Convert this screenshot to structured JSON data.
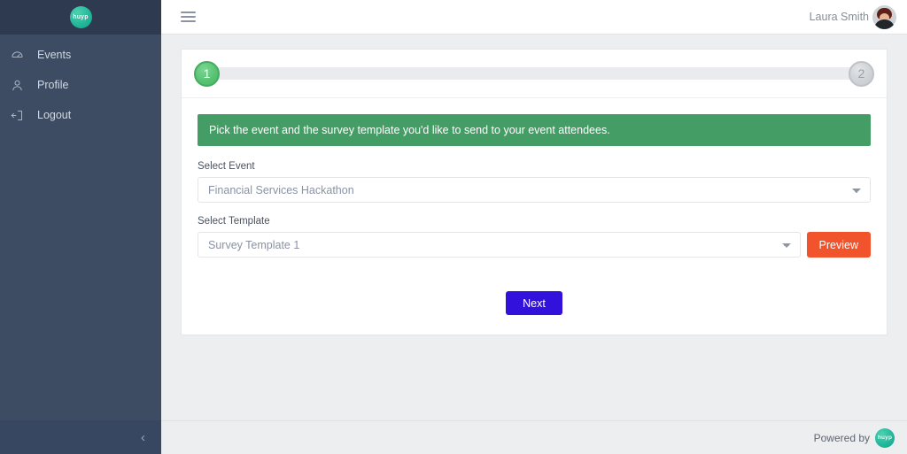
{
  "brand": {
    "logo_text": "huyp",
    "logo_color": "#23b89b"
  },
  "sidebar": {
    "items": [
      {
        "label": "Events",
        "icon": "dashboard-gauge-icon"
      },
      {
        "label": "Profile",
        "icon": "user-icon"
      },
      {
        "label": "Logout",
        "icon": "logout-icon"
      }
    ],
    "collapse_icon": "chevron-left-icon",
    "collapse_glyph": "‹",
    "bg_color": "#3d4c63",
    "header_bg_color": "#2e3a4f"
  },
  "topbar": {
    "menu_toggle_icon": "hamburger-menu-icon",
    "user_name": "Laura Smith",
    "avatar_icon": "user-avatar"
  },
  "stepper": {
    "steps": [
      {
        "number": "1",
        "state": "active"
      },
      {
        "number": "2",
        "state": "inactive"
      }
    ],
    "active_color": "#4fb867",
    "inactive_color": "#c9ccd1",
    "track_color": "#e9ebee"
  },
  "alert": {
    "message": "Pick the event and the survey template you'd like to send to your event attendees.",
    "color": "#449d65"
  },
  "form": {
    "event": {
      "label": "Select Event",
      "value": "Financial Services Hackathon",
      "options": [
        "Financial Services Hackathon"
      ]
    },
    "template": {
      "label": "Select Template",
      "value": "Survey Template 1",
      "options": [
        "Survey Template 1"
      ]
    },
    "preview_button": {
      "label": "Preview",
      "color": "#f1532c"
    },
    "next_button": {
      "label": "Next",
      "color": "#3311dd"
    }
  },
  "footer": {
    "powered_by_text": "Powered by",
    "logo_text": "huyp"
  }
}
